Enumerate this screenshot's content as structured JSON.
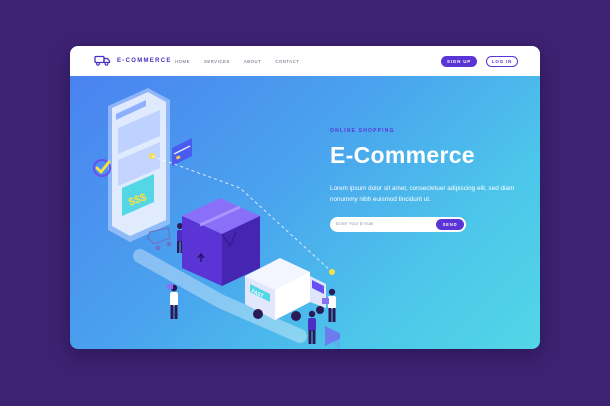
{
  "colors": {
    "page_background": "#3d2272",
    "accent": "#5b34d6",
    "hero_gradient": [
      "#4a7ff0",
      "#53d6e6"
    ]
  },
  "nav": {
    "logo_icon": "delivery-truck-icon",
    "logo_text": "E-COMMERCE",
    "links": [
      "HOME",
      "SERVICES",
      "ABOUT",
      "CONTACT"
    ],
    "signup_label": "SIGN UP",
    "login_label": "LOG IN"
  },
  "hero": {
    "eyebrow": "ONLINE SHOPPING",
    "title": "E-Commerce",
    "description": "Lorem ipsum dolor sit amet, consectetuer adipiscing elit, sed diam nonummy nibh euismod tincidunt ut.",
    "email_placeholder": "Enter Your E-mail",
    "send_label": "SEND"
  },
  "illustration": {
    "items": [
      "smartphone-icon",
      "credit-card-icon",
      "checkmark-icon",
      "shopping-cart-icon",
      "package-box-icon",
      "delivery-van-icon",
      "person-icon"
    ],
    "price_tag_text": "$$$",
    "van_text": "FAST"
  }
}
